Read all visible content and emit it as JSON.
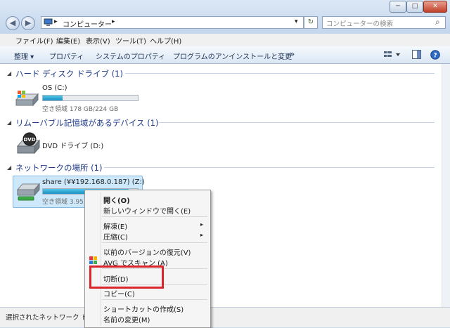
{
  "window": {
    "minimize": "─",
    "maximize": "□",
    "close": "✕",
    "back": "◀",
    "forward": "▶",
    "breadcrumb_sep": "▸",
    "address": "コンピューター",
    "breadcrumb_end": "▸",
    "dropdown": "▾",
    "refresh": "↻",
    "search_placeholder": "コンピューターの検索",
    "search_icon": "⌕"
  },
  "menubar": [
    "ファイル(F)",
    "編集(E)",
    "表示(V)",
    "ツール(T)",
    "ヘルプ(H)"
  ],
  "toolbar": {
    "organize": "整理 ▾",
    "properties": "プロパティ",
    "system_properties": "システムのプロパティ",
    "uninstall": "プログラムのアンインストールと変更",
    "more": "»"
  },
  "groups": {
    "hdd": {
      "header": "ハード ディスク ドライブ (1)",
      "item": {
        "name": "OS (C:)",
        "free": "空き領域 178 GB/224 GB",
        "used_fraction": 0.205
      }
    },
    "removable": {
      "header": "リムーバブル記憶域があるデバイス (1)",
      "item": {
        "name": "DVD ドライブ (D:)",
        "icon_label": "DVD"
      }
    },
    "network": {
      "header": "ネットワークの場所 (1)",
      "item": {
        "name": "share (¥¥192.168.0.187) (Z:)",
        "free": "空き領域 3.95",
        "used_fraction": 0.9
      }
    }
  },
  "status": "選択されたネットワーク ド",
  "context_menu": {
    "open": "開く(O)",
    "open_new_window": "新しいウィンドウで開く(E)",
    "extract": "解凍(E)",
    "compress": "圧縮(C)",
    "restore_previous": "以前のバージョンの復元(V)",
    "avg_scan": "AVG でスキャン (A)",
    "disconnect": "切断(D)",
    "copy": "コピー(C)",
    "create_shortcut": "ショートカットの作成(S)",
    "rename": "名前の変更(M)",
    "submenu_arrow": "▸"
  },
  "colors": {
    "highlight_box": "#d9262c",
    "group_header": "#1e3a8a",
    "selection": "#cde8fb"
  }
}
